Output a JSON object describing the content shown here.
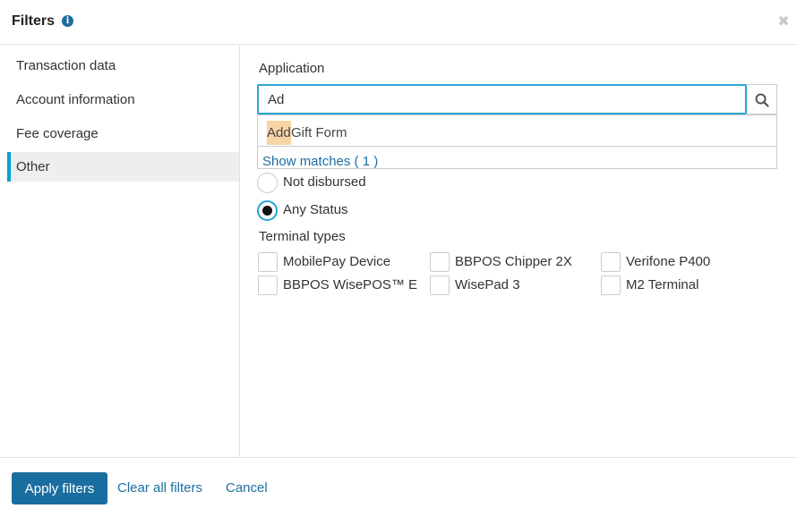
{
  "header": {
    "title": "Filters",
    "info_icon": "i",
    "close_icon": "✖"
  },
  "sidebar": {
    "items": [
      {
        "label": "Transaction data"
      },
      {
        "label": "Account information"
      },
      {
        "label": "Fee coverage"
      },
      {
        "label": "Other",
        "active": true
      }
    ]
  },
  "application": {
    "label": "Application",
    "search_value": "Ad",
    "search_icon": "magnifier",
    "dropdown": {
      "option_highlight": "Add",
      "option_rest": " Gift Form",
      "show_matches": "Show matches ( 1 )"
    }
  },
  "disbursement": {
    "options": [
      {
        "label": "Not disbursed",
        "checked": false
      },
      {
        "label": "Any Status",
        "checked": true
      }
    ]
  },
  "terminal_types": {
    "label": "Terminal types",
    "options": [
      {
        "label": "MobilePay Device"
      },
      {
        "label": "BBPOS Chipper 2X"
      },
      {
        "label": "Verifone P400"
      },
      {
        "label": "BBPOS WisePOS™ E"
      },
      {
        "label": "WisePad 3"
      },
      {
        "label": "M2 Terminal"
      }
    ]
  },
  "footer": {
    "apply_label": "Apply filters",
    "clear_label": "Clear all filters",
    "cancel_label": "Cancel"
  },
  "colors": {
    "accent": "#1a6e9f",
    "focus": "#2aa4d4",
    "highlight": "#f8d3a4",
    "active_bar": "#00a2d6"
  }
}
